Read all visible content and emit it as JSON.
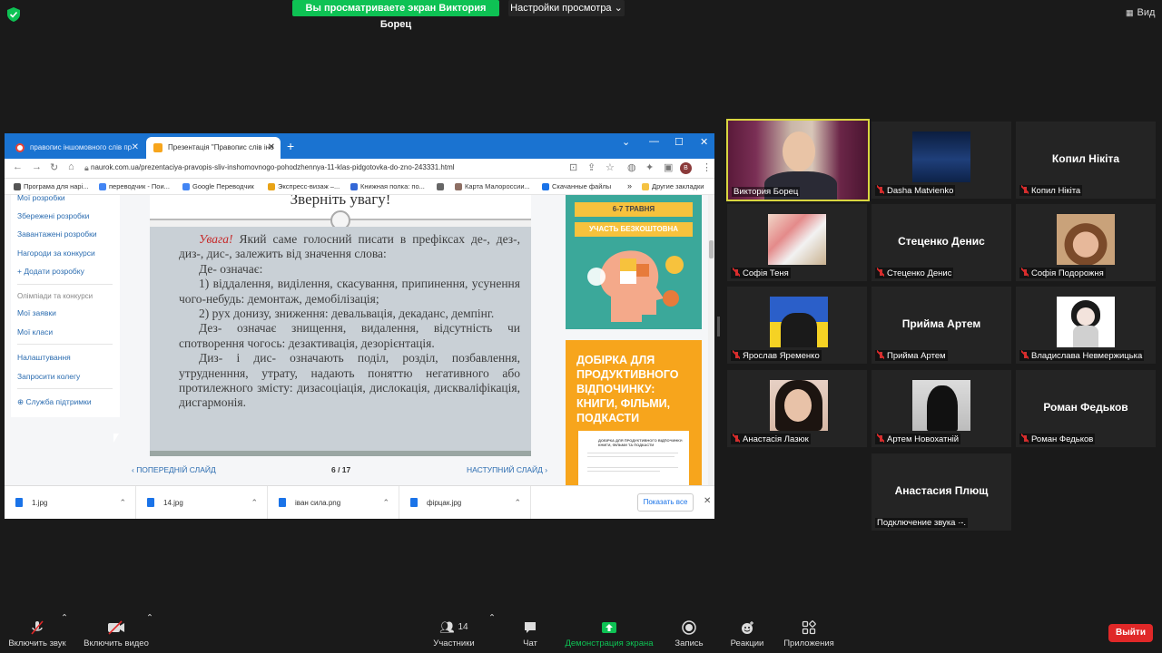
{
  "top": {
    "share_banner": "Вы просматриваете экран Виктория Борец",
    "view_options": "Настройки просмотра ⌄",
    "view_label": "Вид"
  },
  "browser": {
    "tabs": [
      {
        "label": "правопис іншомовного слів пр",
        "close": "✕"
      },
      {
        "label": "Презентація \"Правопис слів іно",
        "close": "✕"
      }
    ],
    "newtab": "+",
    "window_controls": {
      "collapse": "⌄",
      "minimize": "—",
      "maximize": "☐",
      "close": "✕"
    },
    "url": "naurok.com.ua/prezentaciya-pravopis-sliv-inshomovnogo-pohodzhennya-11-klas-pidgotovka-do-zno-243331.html",
    "bookmarks": [
      "Програма для нарі...",
      "переводчик - Пои...",
      "Google Переводчик",
      "Экспресс-визаж –...",
      "Книжная полка: по...",
      "Карта Малороссии...",
      "Скачанные файлы",
      "»",
      "Другие закладки"
    ],
    "side_menu": {
      "items_top": [
        "Мої розробки",
        "Збережені розробки",
        "Завантажені розробки",
        "Нагороди за конкурси",
        "+ Додати розробку"
      ],
      "section_head": "Олімпіади та конкурси",
      "items_mid": [
        "Мої заявки",
        "Мої класи"
      ],
      "items_bottom": [
        "Налаштування",
        "Запросити колегу"
      ],
      "support": "⊕ Служба підтримки"
    },
    "slide": {
      "title": "Зверніть увагу!",
      "warn": "Увага!",
      "p1_rest": " Який саме голосний писати в префіксах де-, дез-, диз-, дис-, залежить від значення слова:",
      "p2": "Де- означає:",
      "p3": "1) віддалення, виділення, скасування, припинення, усунення чого-небудь: демонтаж, демобілізація;",
      "p4": "2) рух донизу, зниження: девальвація, декаданс, демпінг.",
      "p5": "Дез- означає знищення, видалення, відсутність чи спотворення чогось: дезактивація, дезорієнтація.",
      "p6": "Диз- і дис- означають поділ, розділ, позбавлення, утрудненння, утрату, надають поняттю негативного або протилежного змісту: дизасоціація, дислокація, дискваліфікація, дисгармонія."
    },
    "slide_nav": {
      "prev": "‹ ПОПЕРЕДНІЙ СЛАЙД",
      "counter": "6 / 17",
      "next": "НАСТУПНИЙ СЛАЙД ›"
    },
    "ad1": {
      "line1": "6-7 ТРАВНЯ",
      "line2": "УЧАСТЬ БЕЗКОШТОВНА"
    },
    "ad2": {
      "title": "ДОБІРКА ДЛЯ ПРОДУКТИВНОГО ВІДПОЧИНКУ: КНИГИ, ФІЛЬМИ, ПОДКАСТИ",
      "paper_title": "ДОБІРКА ДЛЯ ПРОДУКТИВНОГО ВІДПОЧИНКУ: КНИГИ, ФІЛЬМИ ТА ПОДКАСТИ"
    },
    "downloads": [
      {
        "name": "1.jpg"
      },
      {
        "name": "14.jpg"
      },
      {
        "name": "іван сила.png"
      },
      {
        "name": "фірцак.jpg"
      }
    ],
    "show_all": "Показать все"
  },
  "participants": [
    {
      "name": "Виктория Борец",
      "type": "video",
      "speaking": true
    },
    {
      "name": "Dasha Matvienko",
      "type": "photo",
      "muted": true
    },
    {
      "name": "Копил Нікіта",
      "type": "text",
      "muted": true
    },
    {
      "name": "Софія Теня",
      "type": "photo",
      "muted": true
    },
    {
      "name": "Стеценко Денис",
      "type": "text",
      "muted": true
    },
    {
      "name": "Софія Подорожня",
      "type": "photo",
      "muted": true
    },
    {
      "name": "Ярослав Яременко",
      "type": "photo",
      "muted": true
    },
    {
      "name": "Прийма Артем",
      "type": "text",
      "muted": true
    },
    {
      "name": "Владислава Невмержицька",
      "type": "photo",
      "muted": true
    },
    {
      "name": "Анастасія Лазюк",
      "type": "photo",
      "muted": true
    },
    {
      "name": "Артем Новохатній",
      "type": "photo",
      "muted": true
    },
    {
      "name": "Роман Федьков",
      "type": "text",
      "muted": true
    },
    {
      "name": "Анастасия Плющ",
      "type": "text",
      "status": "Подключение звука ·-."
    }
  ],
  "toolbar": {
    "audio": "Включить звук",
    "video": "Включить видео",
    "participants": "Участники",
    "participants_count": "14",
    "chat": "Чат",
    "share": "Демонстрация экрана",
    "record": "Запись",
    "reactions": "Реакции",
    "apps": "Приложения",
    "leave": "Выйти"
  },
  "colors": {
    "share_green": "#0ec254",
    "leave_red": "#e02828",
    "speaker_border": "#d9d640",
    "chrome_blue": "#1a73d1"
  }
}
